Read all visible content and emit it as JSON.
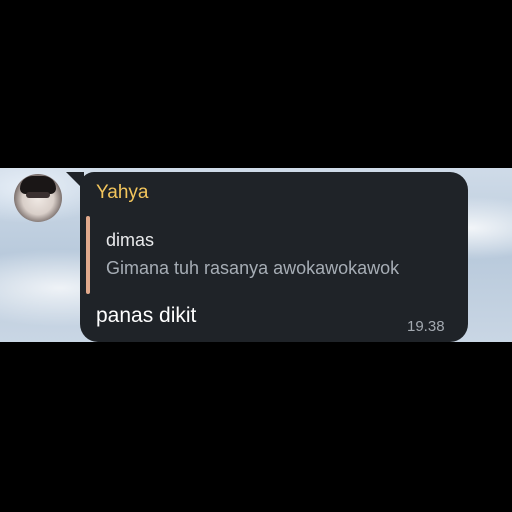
{
  "message": {
    "sender": "Yahya",
    "reply": {
      "author": "dimas",
      "text": "Gimana tuh rasanya awokawokawok"
    },
    "text": "panas dikit",
    "time": "19.38"
  },
  "colors": {
    "bubble": "#1f2328",
    "sender_name": "#f2c55c",
    "reply_bar": "#e1a98c",
    "reply_text": "#a6adb5",
    "timestamp": "#a3a9b0"
  }
}
